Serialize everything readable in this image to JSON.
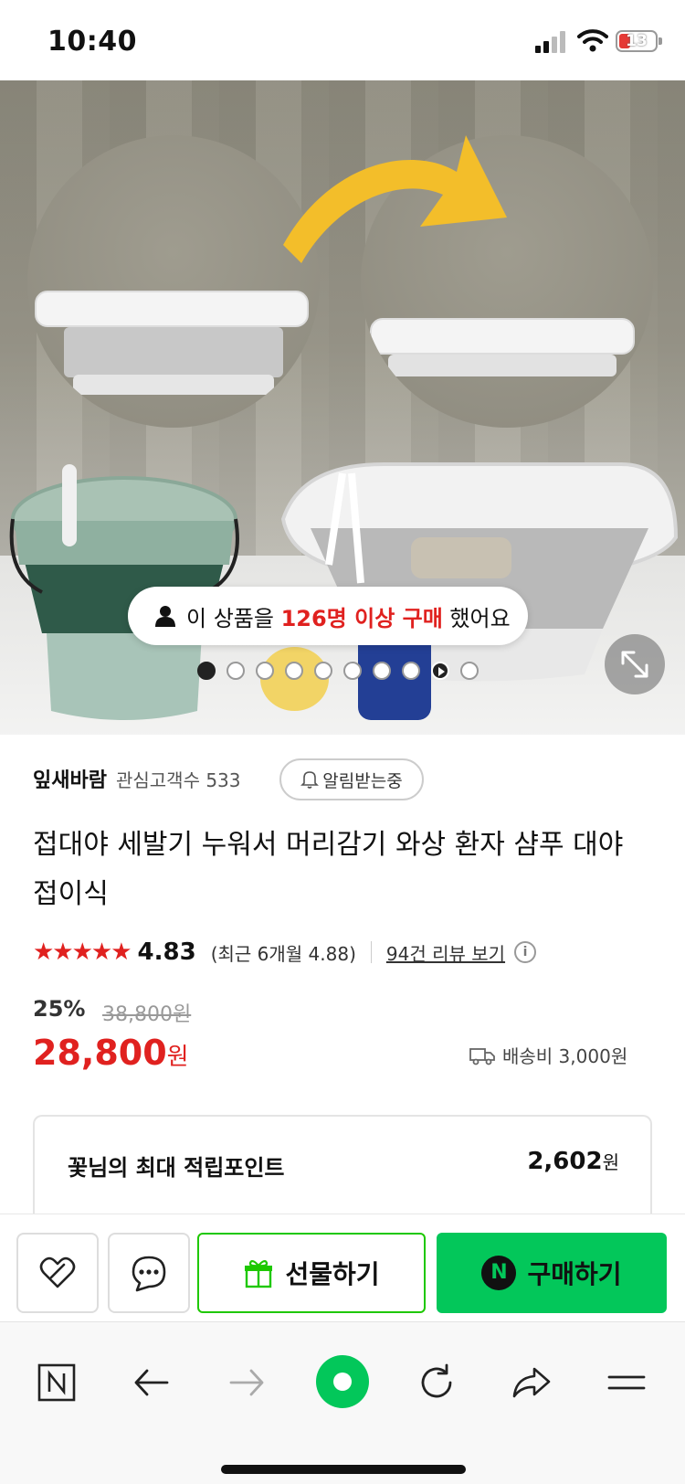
{
  "status_bar": {
    "time": "10:40",
    "battery": "13"
  },
  "hero": {
    "buyers_prefix": "이 상품을 ",
    "buyers_count": "126명 이상 구매",
    "buyers_suffix": " 했어요",
    "slide_count": 10,
    "active_slide": 1
  },
  "store": {
    "name": "잎새바람",
    "fans": "관심고객수 533",
    "alarm_label": "알림받는중"
  },
  "product": {
    "title": "접대야 세발기 누워서 머리감기 와상 환자 샴푸 대야 접이식",
    "stars": "★★★★★",
    "score": "4.83",
    "recent_score": "(최근 6개월 4.88)",
    "reviews_link": "94건 리뷰 보기",
    "discount": "25%",
    "original_price": "38,800원",
    "price": "28,800",
    "price_unit": "원",
    "shipping": "배송비 3,000원"
  },
  "points": {
    "label": "꽃님의 최대 적립포인트",
    "value": "2,602",
    "unit": "원"
  },
  "buybar": {
    "gift_label": "선물하기",
    "buy_label": "구매하기",
    "naver_badge": "N"
  },
  "browser": {
    "icons": [
      "naver-n-icon",
      "back-arrow-icon",
      "forward-arrow-icon",
      "green-circle-home-icon",
      "refresh-icon",
      "share-icon",
      "menu-icon"
    ]
  },
  "colors": {
    "accent_red": "#e0211f",
    "naver_green": "#03c75a",
    "gift_border": "#1ec800"
  }
}
